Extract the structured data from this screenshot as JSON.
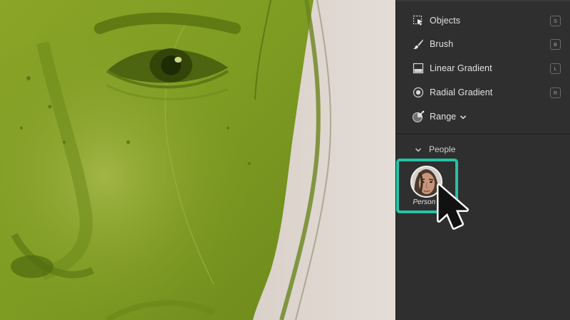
{
  "panel": {
    "tools": [
      {
        "label": "Objects",
        "shortcut": "S",
        "icon": "objects-select-icon"
      },
      {
        "label": "Brush",
        "shortcut": "B",
        "icon": "brush-icon"
      },
      {
        "label": "Linear Gradient",
        "shortcut": "L",
        "icon": "linear-gradient-icon"
      },
      {
        "label": "Radial Gradient",
        "shortcut": "R",
        "icon": "radial-gradient-icon"
      },
      {
        "label": "Range",
        "shortcut": "",
        "icon": "range-icon",
        "has_dropdown": true
      }
    ],
    "people_section": {
      "label": "People",
      "expanded": true,
      "persons": [
        {
          "label": "Person 1",
          "selected": true
        }
      ]
    }
  },
  "canvas": {
    "overlay_color": "#7b9b22",
    "description_hidden": true
  },
  "colors": {
    "panel_bg": "#2f2f2f",
    "highlight": "#27c2a6",
    "text": "#e2e2e2"
  }
}
